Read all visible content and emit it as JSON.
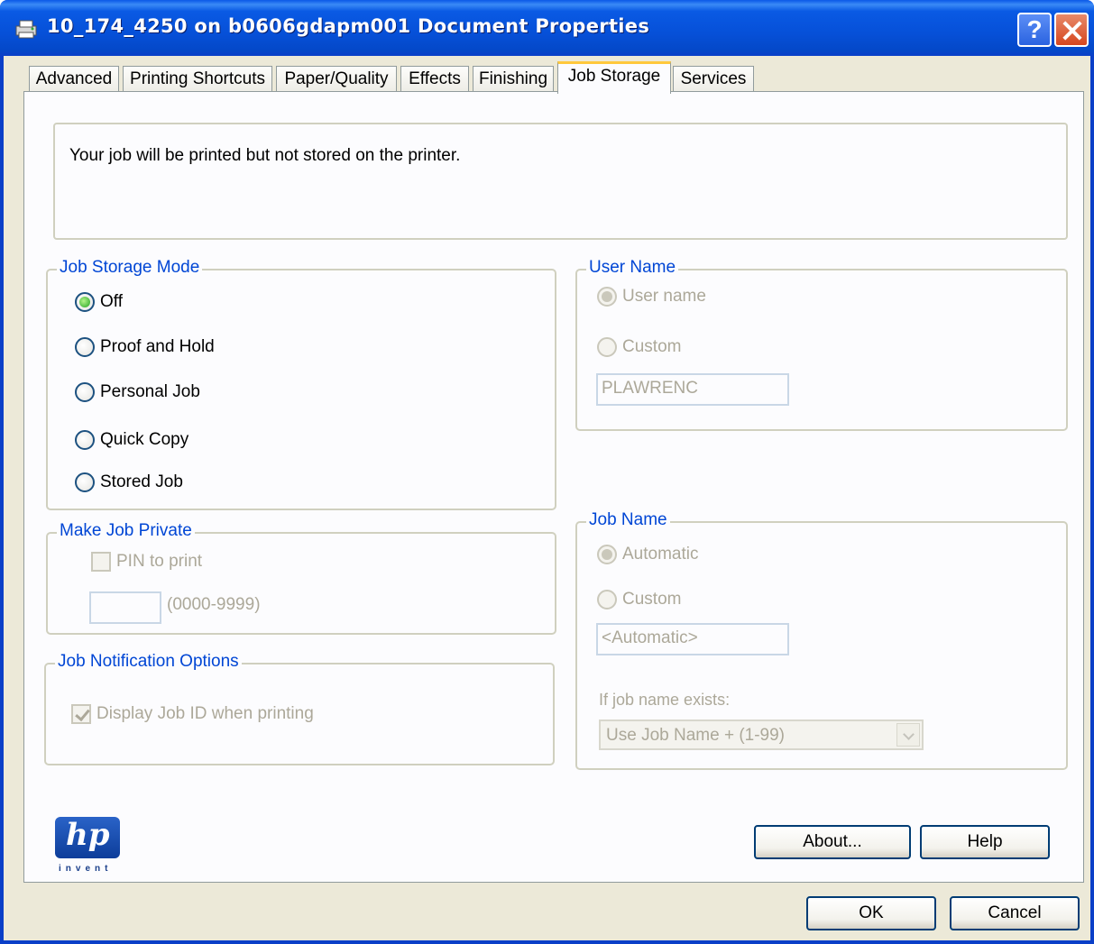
{
  "window": {
    "title": "10_174_4250 on b0606gdapm001 Document Properties",
    "help_button": "?"
  },
  "tabs": [
    {
      "label": "Advanced"
    },
    {
      "label": "Printing Shortcuts"
    },
    {
      "label": "Paper/Quality"
    },
    {
      "label": "Effects"
    },
    {
      "label": "Finishing"
    },
    {
      "label": "Job Storage",
      "active": true
    },
    {
      "label": "Services"
    }
  ],
  "info": {
    "message": "Your job will be printed but not stored on the printer."
  },
  "job_storage_mode": {
    "legend": "Job Storage Mode",
    "options": [
      {
        "label": "Off",
        "checked": true
      },
      {
        "label": "Proof and Hold",
        "checked": false
      },
      {
        "label": "Personal Job",
        "checked": false
      },
      {
        "label": "Quick Copy",
        "checked": false
      },
      {
        "label": "Stored Job",
        "checked": false
      }
    ]
  },
  "make_job_private": {
    "legend": "Make Job Private",
    "pin_label": "PIN to print",
    "pin_range": "(0000-9999)",
    "pin_value": ""
  },
  "job_notification": {
    "legend": "Job Notification Options",
    "display_job_id_label": "Display Job ID when printing",
    "display_job_id_checked": true
  },
  "user_name": {
    "legend": "User Name",
    "option_user_name": "User name",
    "option_custom": "Custom",
    "value": "PLAWRENC"
  },
  "job_name": {
    "legend": "Job Name",
    "option_automatic": "Automatic",
    "option_custom": "Custom",
    "value": "<Automatic>",
    "exists_label": "If job name exists:",
    "exists_selected": "Use Job Name + (1-99)"
  },
  "buttons": {
    "about": "About...",
    "help": "Help",
    "ok": "OK",
    "cancel": "Cancel"
  },
  "logo": {
    "text": "hp",
    "tagline": "invent"
  }
}
